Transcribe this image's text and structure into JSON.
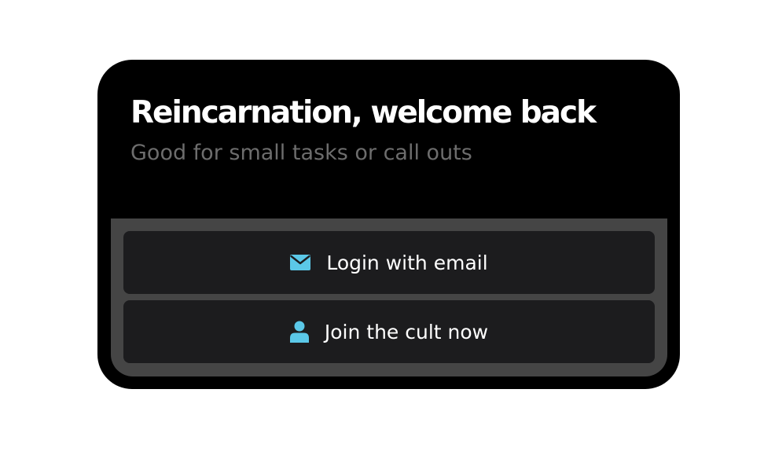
{
  "card": {
    "title": "Reincarnation, welcome back",
    "subtitle": "Good for small tasks or call outs"
  },
  "actions": [
    {
      "label": "Login with email",
      "icon": "mail-icon"
    },
    {
      "label": "Join the cult now",
      "icon": "user-icon"
    }
  ],
  "colors": {
    "card_background": "#000000",
    "tray_background": "#454545",
    "button_background": "#1c1c1e",
    "icon_accent": "#5bc8e8",
    "subtitle_text": "#6d6d6d"
  }
}
